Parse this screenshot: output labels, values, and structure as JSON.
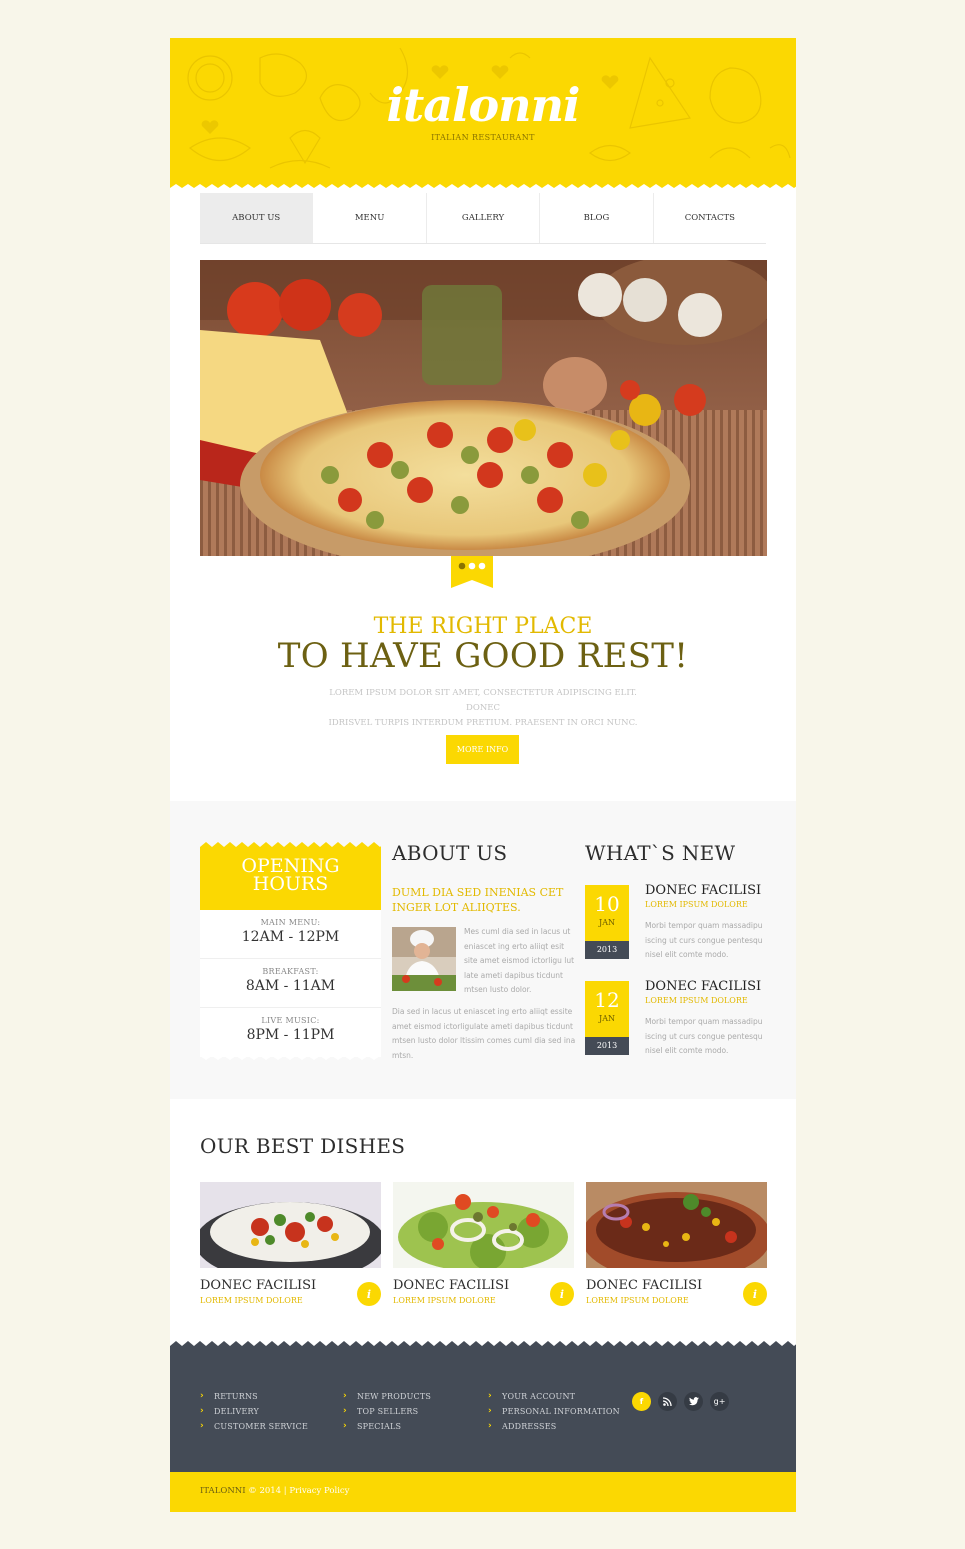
{
  "brand": {
    "logo": "italonni",
    "tagline": "ITALIAN RESTAURANT"
  },
  "nav": {
    "items": [
      "ABOUT US",
      "MENU",
      "GALLERY",
      "BLOG",
      "CONTACTS"
    ],
    "active": "ABOUT US"
  },
  "slider": {
    "slide_count": 3,
    "active_slide": 1
  },
  "hero": {
    "subtitle": "THE RIGHT PLACE",
    "title": "TO HAVE GOOD REST!",
    "text_line1": "LOREM IPSUM DOLOR SIT AMET, CONSECTETUR ADIPISCING ELIT. DONEC",
    "text_line2": "IDRISVEL TURPIS INTERDUM PRETIUM. PRAESENT IN ORCI NUNC.",
    "button": "MORE INFO"
  },
  "hours": {
    "title_line1": "OPENING",
    "title_line2": "HOURS",
    "rows": [
      {
        "label": "MAIN MENU:",
        "value": "12AM - 12PM"
      },
      {
        "label": "BREAKFAST:",
        "value": "8AM - 11AM"
      },
      {
        "label": "LIVE MUSIC:",
        "value": "8PM - 11PM"
      }
    ]
  },
  "about": {
    "title": "ABOUT US",
    "lead": "DUML DIA SED INENIAS CET INGER LOT ALIIQTES.",
    "side_text": "Mes cuml dia sed in lacus ut eniascet ing erto aliiqt esit site amet eismod ictorligu lut late ameti dapibus ticdunt mtsen lusto dolor.",
    "bottom_text": "Dia sed in lacus ut eniascet ing erto aliiqt essite amet eismod ictorligulate ameti dapibus ticdunt mtsen lusto dolor ltissim comes cuml dia sed ina mtsn."
  },
  "news": {
    "title": "WHAT`S NEW",
    "items": [
      {
        "day": "10",
        "month": "JAN",
        "year": "2013",
        "title": "DONEC FACILISI",
        "sub": "LOREM IPSUM DOLORE",
        "text": "Morbi tempor quam massadipu iscing ut curs congue pentesqu nisel elit comte modo."
      },
      {
        "day": "12",
        "month": "JAN",
        "year": "2013",
        "title": "DONEC FACILISI",
        "sub": "LOREM IPSUM DOLORE",
        "text": "Morbi tempor quam massadipu iscing ut curs congue pentesqu nisel elit comte modo."
      }
    ]
  },
  "dishes": {
    "title": "OUR BEST DISHES",
    "items": [
      {
        "name": "DONEC FACILISI",
        "sub": "LOREM IPSUM DOLORE",
        "info_icon": "i"
      },
      {
        "name": "DONEC FACILISI",
        "sub": "LOREM IPSUM DOLORE",
        "info_icon": "i"
      },
      {
        "name": "DONEC FACILISI",
        "sub": "LOREM IPSUM DOLORE",
        "info_icon": "i"
      }
    ]
  },
  "footer": {
    "col1": [
      "RETURNS",
      "DELIVERY",
      "CUSTOMER SERVICE"
    ],
    "col2": [
      "NEW PRODUCTS",
      "TOP SELLERS",
      "SPECIALS"
    ],
    "col3": [
      "YOUR ACCOUNT",
      "PERSONAL INFORMATION",
      "ADDRESSES"
    ],
    "social": [
      {
        "icon": "facebook-icon",
        "glyph": "f"
      },
      {
        "icon": "rss-icon",
        "glyph": ""
      },
      {
        "icon": "twitter-icon",
        "glyph": ""
      },
      {
        "icon": "google-plus-icon",
        "glyph": "g+"
      }
    ],
    "copyright_brand": "ITALONNI",
    "copyright_year": "© 2014 |",
    "privacy": "Privacy Policy"
  },
  "colors": {
    "accent": "#fbd802",
    "dark": "#444b56",
    "olive": "#6c6012",
    "background": "#f8f6ea"
  }
}
